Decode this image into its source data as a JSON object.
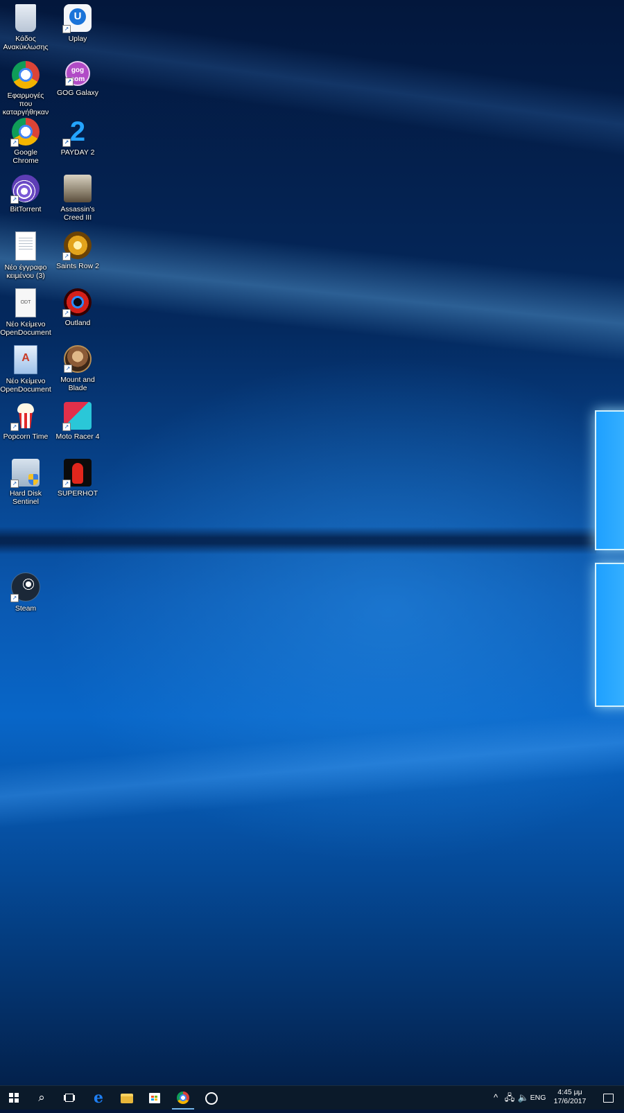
{
  "desktop": {
    "column1": [
      {
        "label": "Κάδος Ανακύκλωσης",
        "icon": "recycle-bin-icon",
        "shortcut": false
      },
      {
        "label": "Εφαρμογές που καταργήθηκαν",
        "icon": "chrome-icon",
        "shortcut": false
      },
      {
        "label": "Google Chrome",
        "icon": "chrome-icon",
        "shortcut": true
      },
      {
        "label": "BitTorrent",
        "icon": "bittorrent-icon",
        "shortcut": true
      },
      {
        "label": "Νέο έγγραφο κειμένου (3)",
        "icon": "text-document-icon",
        "shortcut": false
      },
      {
        "label": "Νέο Κείμενο OpenDocument",
        "icon": "odt-document-icon",
        "shortcut": false
      },
      {
        "label": "Νέο Κείμενο OpenDocument",
        "icon": "writer-document-icon",
        "shortcut": false
      },
      {
        "label": "Popcorn Time",
        "icon": "popcorn-icon",
        "shortcut": true
      },
      {
        "label": "Hard Disk Sentinel",
        "icon": "hard-disk-sentinel-icon",
        "shortcut": true
      },
      {
        "label": "Steam",
        "icon": "steam-icon",
        "shortcut": true
      }
    ],
    "column2": [
      {
        "label": "Uplay",
        "icon": "uplay-icon",
        "shortcut": true
      },
      {
        "label": "GOG Galaxy",
        "icon": "gog-galaxy-icon",
        "shortcut": true
      },
      {
        "label": "PAYDAY 2",
        "icon": "payday-icon",
        "shortcut": true
      },
      {
        "label": "Assassin's Creed III",
        "icon": "assassins-creed-icon",
        "shortcut": false
      },
      {
        "label": "Saints Row 2",
        "icon": "saints-row-icon",
        "shortcut": true
      },
      {
        "label": "Outland",
        "icon": "outland-icon",
        "shortcut": true
      },
      {
        "label": "Mount and Blade",
        "icon": "mount-and-blade-icon",
        "shortcut": true
      },
      {
        "label": "Moto Racer 4",
        "icon": "moto-racer-icon",
        "shortcut": true
      },
      {
        "label": "SUPERHOT",
        "icon": "superhot-icon",
        "shortcut": true
      }
    ],
    "gog_text": "gog com"
  },
  "taskbar": {
    "pinned": [
      {
        "name": "start",
        "icon": "windows-start-icon"
      },
      {
        "name": "search",
        "icon": "search-icon",
        "glyph": "⌕"
      },
      {
        "name": "task-view",
        "icon": "task-view-icon"
      },
      {
        "name": "edge",
        "icon": "edge-icon",
        "glyph": "e"
      },
      {
        "name": "file-explorer",
        "icon": "folder-icon"
      },
      {
        "name": "store",
        "icon": "store-icon"
      },
      {
        "name": "chrome",
        "icon": "chrome-icon",
        "active": true
      },
      {
        "name": "alarms",
        "icon": "alarm-clock-icon"
      }
    ],
    "tray": {
      "overflow_glyph": "^",
      "network_glyph": "🖧",
      "volume_glyph": "🔈",
      "language": "ENG",
      "time": "4:45 μμ",
      "date": "17/6/2017"
    }
  },
  "colors": {
    "taskbar_bg": "#0b1a2a",
    "accent_underline": "#76b9ed",
    "wallpaper_glow": "#1ea0ff"
  }
}
